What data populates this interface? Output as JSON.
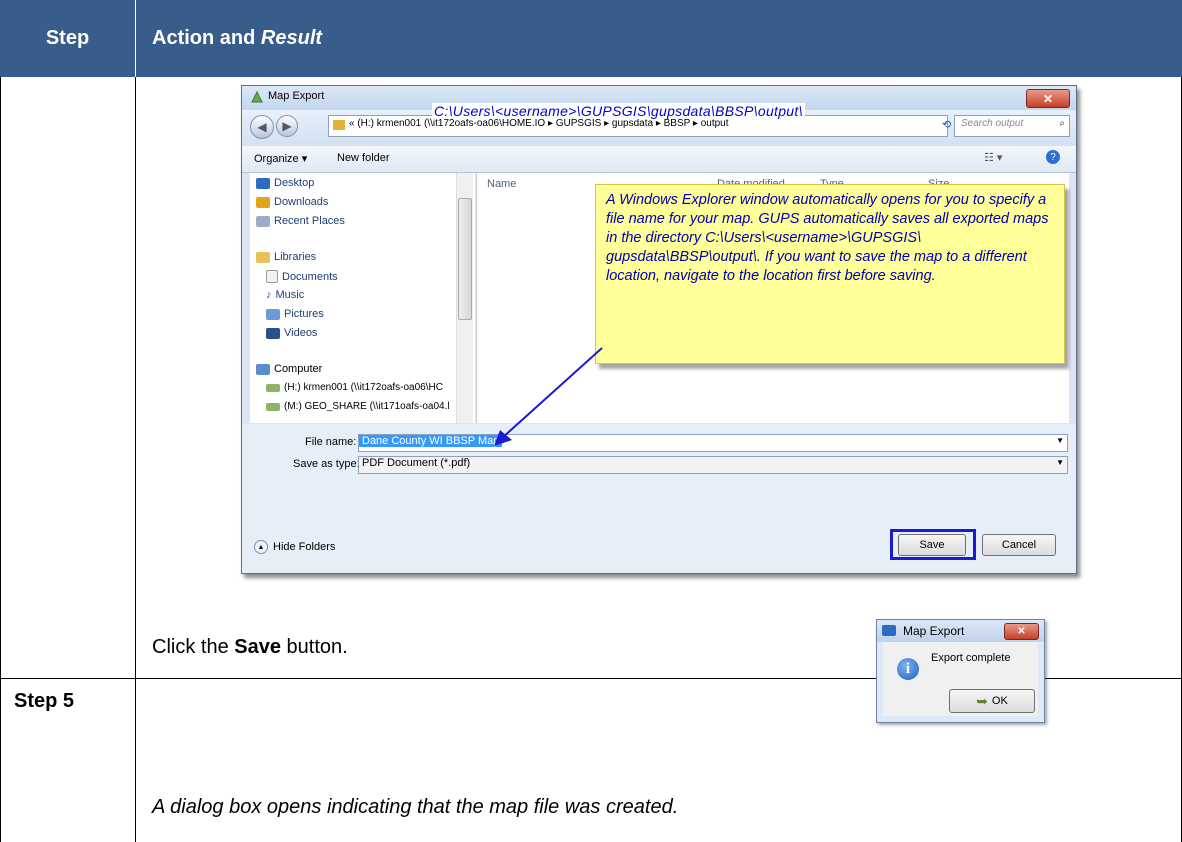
{
  "table": {
    "header_step": "Step",
    "header_action": "Action and",
    "header_result": "Result",
    "row1": {
      "step": "",
      "instruction_prefix": "Click the ",
      "instruction_bold": "Save",
      "instruction_suffix": " button."
    },
    "row2": {
      "step": "Step 5",
      "text": "A dialog box opens indicating that the map file was created."
    }
  },
  "save_dialog": {
    "title": "Map Export",
    "close_glyph": "✕",
    "address_path": "« (H:) krmen001 (\\\\it172oafs-oa06\\HOME.IO ▸ GUPSGIS ▸ gupsdata ▸ BBSP ▸ output",
    "address_overlay": "C:\\Users\\<username>\\GUPSGIS\\gupsdata\\BBSP\\output\\",
    "search_placeholder": "Search output",
    "toolbar": {
      "organize": "Organize ▾",
      "new_folder": "New folder"
    },
    "nav": {
      "desktop": "Desktop",
      "downloads": "Downloads",
      "recent": "Recent Places",
      "libraries": "Libraries",
      "documents": "Documents",
      "music": "Music",
      "pictures": "Pictures",
      "videos": "Videos",
      "computer": "Computer",
      "drive_h": "(H:) krmen001 (\\\\it172oafs-oa06\\HC",
      "drive_m": "(M:) GEO_SHARE (\\\\it171oafs-oa04.l"
    },
    "columns": {
      "name": "Name",
      "date": "Date modified",
      "type": "Type",
      "size": "Size"
    },
    "callout": "A Windows Explorer window automatically opens for you to specify a file name for your map. GUPS automatically saves all exported maps in the directory C:\\Users\\<username>\\GUPSGIS\\ gupsdata\\BBSP\\output\\. If you want to save the map to a different location, navigate to the location first before saving.",
    "file_name_label": "File name:",
    "file_name_value": "Dane County WI BBSP Map",
    "save_type_label": "Save as type:",
    "save_type_value": "PDF Document (*.pdf)",
    "hide_folders": "Hide Folders",
    "save_button": "Save",
    "cancel_button": "Cancel"
  },
  "export_dialog": {
    "title": "Map Export",
    "message": "Export complete",
    "ok_button": "OK"
  },
  "colors": {
    "header_bg": "#385d8a",
    "callout_bg": "#ffff99",
    "callout_text": "#0000aa",
    "save_highlight": "#1a1ad6"
  }
}
